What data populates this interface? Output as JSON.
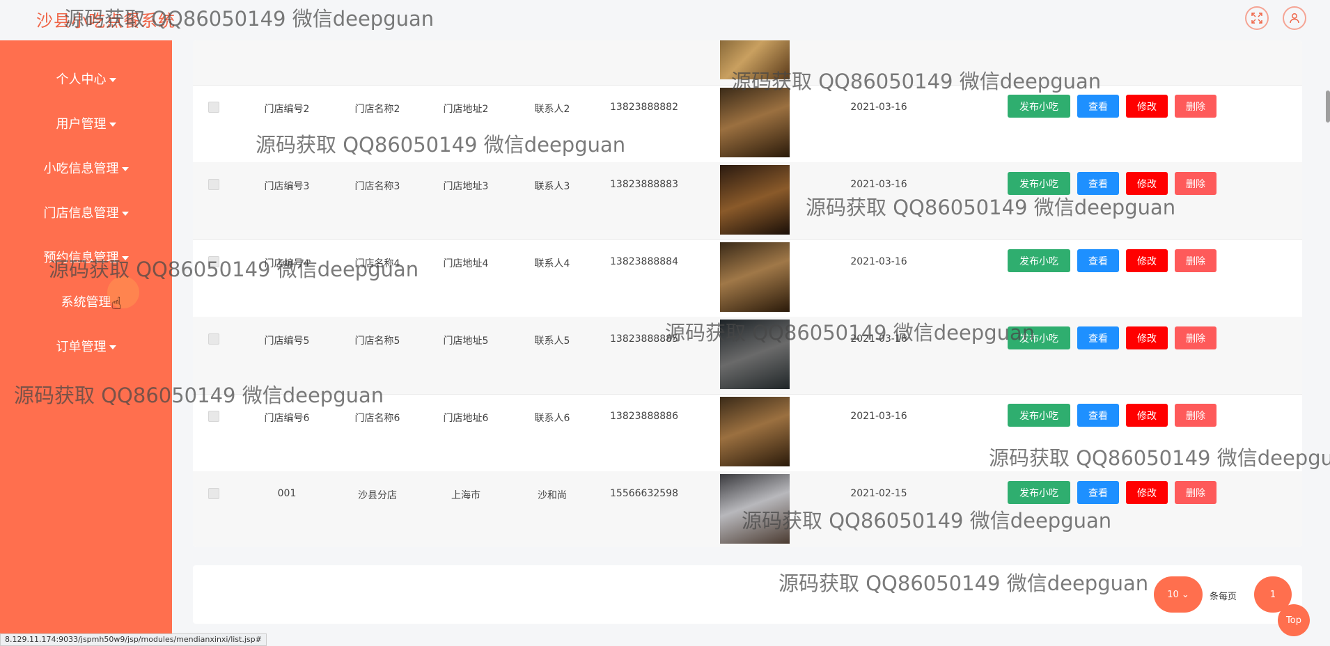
{
  "app_title": "沙县小吃点餐系统",
  "header_icons": [
    "fullscreen-icon",
    "user-icon"
  ],
  "sidebar": {
    "items": [
      {
        "label": "个人中心"
      },
      {
        "label": "用户管理"
      },
      {
        "label": "小吃信息管理"
      },
      {
        "label": "门店信息管理"
      },
      {
        "label": "预约信息管理"
      },
      {
        "label": "系统管理"
      },
      {
        "label": "订单管理"
      }
    ]
  },
  "row_actions": {
    "publish": "发布小吃",
    "view": "查看",
    "edit": "修改",
    "delete": "删除"
  },
  "rows": [
    {
      "code": "门店编号2",
      "name": "门店名称2",
      "address": "门店地址2",
      "contact": "联系人2",
      "phone": "13823888882",
      "date": "2021-03-16"
    },
    {
      "code": "门店编号3",
      "name": "门店名称3",
      "address": "门店地址3",
      "contact": "联系人3",
      "phone": "13823888883",
      "date": "2021-03-16"
    },
    {
      "code": "门店编号4",
      "name": "门店名称4",
      "address": "门店地址4",
      "contact": "联系人4",
      "phone": "13823888884",
      "date": "2021-03-16"
    },
    {
      "code": "门店编号5",
      "name": "门店名称5",
      "address": "门店地址5",
      "contact": "联系人5",
      "phone": "13823888885",
      "date": "2021-03-16"
    },
    {
      "code": "门店编号6",
      "name": "门店名称6",
      "address": "门店地址6",
      "contact": "联系人6",
      "phone": "13823888886",
      "date": "2021-03-16"
    },
    {
      "code": "001",
      "name": "沙县分店",
      "address": "上海市",
      "contact": "沙和尚",
      "phone": "15566632598",
      "date": "2021-02-15"
    }
  ],
  "pagination": {
    "page_size": "10",
    "per_page_label": "条每页",
    "current_page": "1"
  },
  "back_to_top": "Top",
  "status_url": "8.129.11.174:9033/jspmh50w9/jsp/modules/mendianxinxi/list.jsp#",
  "watermark": "源码获取 QQ86050149 微信deepguan",
  "colors": {
    "accent": "#ff6f4e",
    "publish": "#2fae6f",
    "view": "#1e90ff",
    "edit": "#ff0000",
    "delete": "#fe5a5a"
  }
}
